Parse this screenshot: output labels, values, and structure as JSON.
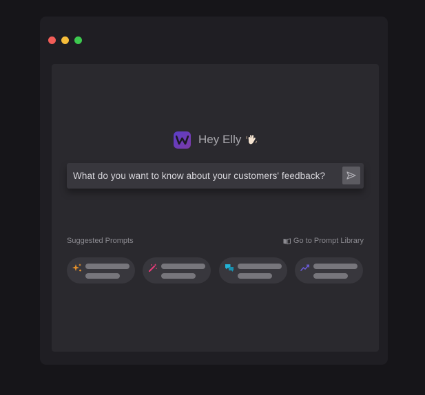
{
  "greeting": {
    "text": "Hey Elly",
    "wave_icon": "waving-hand-icon"
  },
  "logo": {
    "icon": "app-logo-icon",
    "color": "#5a3ec8"
  },
  "search": {
    "text": "What do you want to know about your customers' feedback?",
    "send_icon": "send-icon"
  },
  "suggested": {
    "label": "Suggested Prompts",
    "library_link": "Go to Prompt Library",
    "library_icon": "book-icon"
  },
  "prompts": [
    {
      "icon": "sparkle-icon",
      "color": "#e5902b"
    },
    {
      "icon": "magic-wand-icon",
      "color": "#e53a78"
    },
    {
      "icon": "chat-bubbles-icon",
      "color": "#22b3d6"
    },
    {
      "icon": "trend-line-icon",
      "color": "#6b5bd8"
    }
  ],
  "window_controls": [
    "close",
    "minimize",
    "maximize"
  ]
}
